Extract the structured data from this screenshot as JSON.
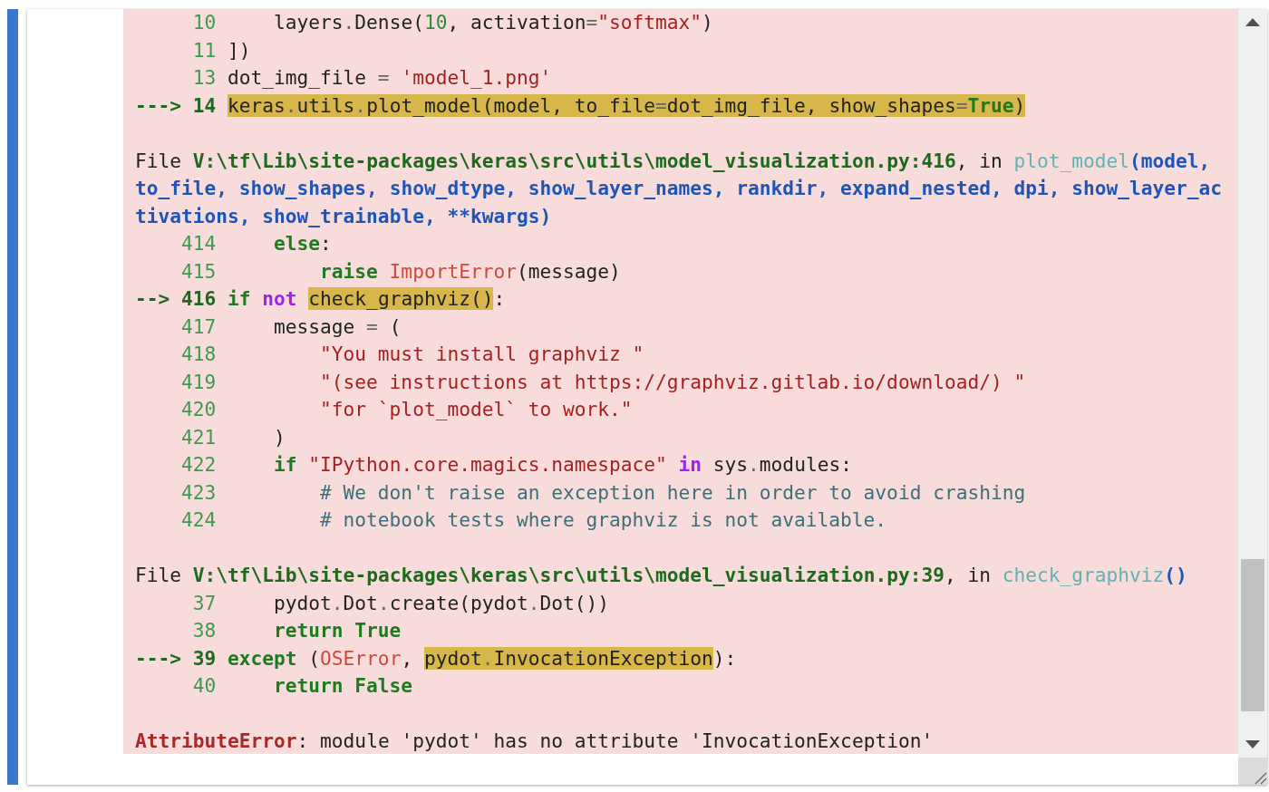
{
  "lines": [
    {
      "kind": "code",
      "number": "10",
      "current": false,
      "tokens": [
        {
          "text": "    layers",
          "kind": "plain",
          "highlighted": false
        },
        {
          "text": ".",
          "kind": "op",
          "highlighted": false
        },
        {
          "text": "Dense(",
          "kind": "plain",
          "highlighted": false
        },
        {
          "text": "10",
          "kind": "num",
          "highlighted": false
        },
        {
          "text": ", activation",
          "kind": "plain",
          "highlighted": false
        },
        {
          "text": "=",
          "kind": "op",
          "highlighted": false
        },
        {
          "text": "\"softmax\"",
          "kind": "str",
          "highlighted": false
        },
        {
          "text": ")",
          "kind": "plain",
          "highlighted": false
        }
      ]
    },
    {
      "kind": "code",
      "number": "11",
      "current": false,
      "tokens": [
        {
          "text": "])",
          "kind": "plain",
          "highlighted": false
        }
      ]
    },
    {
      "kind": "code",
      "number": "13",
      "current": false,
      "tokens": [
        {
          "text": "dot_img_file ",
          "kind": "plain",
          "highlighted": false
        },
        {
          "text": "=",
          "kind": "op",
          "highlighted": false
        },
        {
          "text": " 'model_1.png'",
          "kind": "str",
          "highlighted": false
        }
      ]
    },
    {
      "kind": "code",
      "arrow": "--->",
      "number": "14",
      "current": true,
      "tokens": [
        {
          "text": "keras",
          "kind": "plain",
          "highlighted": true
        },
        {
          "text": ".",
          "kind": "op",
          "highlighted": true
        },
        {
          "text": "utils",
          "kind": "plain",
          "highlighted": true
        },
        {
          "text": ".",
          "kind": "op",
          "highlighted": true
        },
        {
          "text": "plot_model(model, to_file",
          "kind": "plain",
          "highlighted": true
        },
        {
          "text": "=",
          "kind": "op",
          "highlighted": true
        },
        {
          "text": "dot_img_file, show_shapes",
          "kind": "plain",
          "highlighted": true
        },
        {
          "text": "=",
          "kind": "op",
          "highlighted": true
        },
        {
          "text": "True",
          "kind": "kw",
          "highlighted": true
        },
        {
          "text": ")",
          "kind": "plain",
          "highlighted": true
        }
      ]
    },
    {
      "kind": "blank"
    },
    {
      "kind": "file",
      "prefix": "File",
      "path": "V:\\tf\\Lib\\site-packages\\keras\\src\\utils\\model_visualization.py:416",
      "middle": ", in",
      "func": "plot_model",
      "args": "(model, to_file, show_shapes, show_dtype, show_layer_names, rankdir, expand_nested, dpi, show_layer_activations, show_trainable, **kwargs)"
    },
    {
      "kind": "code",
      "number": "414",
      "current": false,
      "tokens": [
        {
          "text": "    else",
          "kind": "kw",
          "highlighted": false
        },
        {
          "text": ":",
          "kind": "plain",
          "highlighted": false
        }
      ]
    },
    {
      "kind": "code",
      "number": "415",
      "current": false,
      "tokens": [
        {
          "text": "        raise",
          "kind": "kw",
          "highlighted": false
        },
        {
          "text": " ImportError",
          "kind": "exc",
          "highlighted": false
        },
        {
          "text": "(message)",
          "kind": "plain",
          "highlighted": false
        }
      ]
    },
    {
      "kind": "code",
      "arrow": "-->",
      "number": "416",
      "current": true,
      "tokens": [
        {
          "text": "if ",
          "kind": "kw",
          "highlighted": false
        },
        {
          "text": "not ",
          "kind": "kwop",
          "highlighted": false
        },
        {
          "text": "check_graphviz()",
          "kind": "plain",
          "highlighted": true
        },
        {
          "text": ":",
          "kind": "plain",
          "highlighted": false
        }
      ]
    },
    {
      "kind": "code",
      "number": "417",
      "current": false,
      "tokens": [
        {
          "text": "    message ",
          "kind": "plain",
          "highlighted": false
        },
        {
          "text": "=",
          "kind": "op",
          "highlighted": false
        },
        {
          "text": " (",
          "kind": "plain",
          "highlighted": false
        }
      ]
    },
    {
      "kind": "code",
      "number": "418",
      "current": false,
      "tokens": [
        {
          "text": "        \"You must install graphviz \"",
          "kind": "str",
          "highlighted": false
        }
      ]
    },
    {
      "kind": "code",
      "number": "419",
      "current": false,
      "tokens": [
        {
          "text": "        \"(see instructions at https://graphviz.gitlab.io/download/) \"",
          "kind": "str",
          "highlighted": false
        }
      ]
    },
    {
      "kind": "code",
      "number": "420",
      "current": false,
      "tokens": [
        {
          "text": "        \"for `plot_model` to work.\"",
          "kind": "str",
          "highlighted": false
        }
      ]
    },
    {
      "kind": "code",
      "number": "421",
      "current": false,
      "tokens": [
        {
          "text": "    )",
          "kind": "plain",
          "highlighted": false
        }
      ]
    },
    {
      "kind": "code",
      "number": "422",
      "current": false,
      "tokens": [
        {
          "text": "    if",
          "kind": "kw",
          "highlighted": false
        },
        {
          "text": " \"IPython.core.magics.namespace\"",
          "kind": "str",
          "highlighted": false
        },
        {
          "text": " in",
          "kind": "kwop",
          "highlighted": false
        },
        {
          "text": " sys",
          "kind": "plain",
          "highlighted": false
        },
        {
          "text": ".",
          "kind": "op",
          "highlighted": false
        },
        {
          "text": "modules:",
          "kind": "plain",
          "highlighted": false
        }
      ]
    },
    {
      "kind": "code",
      "number": "423",
      "current": false,
      "tokens": [
        {
          "text": "        # We don't raise an exception here in order to avoid crashing",
          "kind": "comment",
          "highlighted": false
        }
      ]
    },
    {
      "kind": "code",
      "number": "424",
      "current": false,
      "tokens": [
        {
          "text": "        # notebook tests where graphviz is not available.",
          "kind": "comment",
          "highlighted": false
        }
      ]
    },
    {
      "kind": "blank"
    },
    {
      "kind": "file",
      "prefix": "File",
      "path": "V:\\tf\\Lib\\site-packages\\keras\\src\\utils\\model_visualization.py:39",
      "middle": ", in",
      "func": "check_graphviz",
      "args": "()"
    },
    {
      "kind": "code",
      "number": "37",
      "current": false,
      "tokens": [
        {
          "text": "    pydot",
          "kind": "plain",
          "highlighted": false
        },
        {
          "text": ".",
          "kind": "op",
          "highlighted": false
        },
        {
          "text": "Dot",
          "kind": "plain",
          "highlighted": false
        },
        {
          "text": ".",
          "kind": "op",
          "highlighted": false
        },
        {
          "text": "create(pydot",
          "kind": "plain",
          "highlighted": false
        },
        {
          "text": ".",
          "kind": "op",
          "highlighted": false
        },
        {
          "text": "Dot())",
          "kind": "plain",
          "highlighted": false
        }
      ]
    },
    {
      "kind": "code",
      "number": "38",
      "current": false,
      "tokens": [
        {
          "text": "    return True",
          "kind": "kw",
          "highlighted": false
        }
      ]
    },
    {
      "kind": "code",
      "arrow": "--->",
      "number": "39",
      "current": true,
      "tokens": [
        {
          "text": "except",
          "kind": "kw",
          "highlighted": false
        },
        {
          "text": " (",
          "kind": "plain",
          "highlighted": false
        },
        {
          "text": "OSError",
          "kind": "exc",
          "highlighted": false
        },
        {
          "text": ", ",
          "kind": "plain",
          "highlighted": false
        },
        {
          "text": "pydot",
          "kind": "plain",
          "highlighted": true
        },
        {
          "text": ".",
          "kind": "op",
          "highlighted": true
        },
        {
          "text": "InvocationException",
          "kind": "plain",
          "highlighted": true
        },
        {
          "text": "):",
          "kind": "plain",
          "highlighted": false
        }
      ]
    },
    {
      "kind": "code",
      "number": "40",
      "current": false,
      "tokens": [
        {
          "text": "    return False",
          "kind": "kw",
          "highlighted": false
        }
      ]
    },
    {
      "kind": "blank"
    },
    {
      "kind": "error",
      "name": "AttributeError",
      "message": ": module 'pydot' has no attribute 'InvocationException'"
    }
  ]
}
